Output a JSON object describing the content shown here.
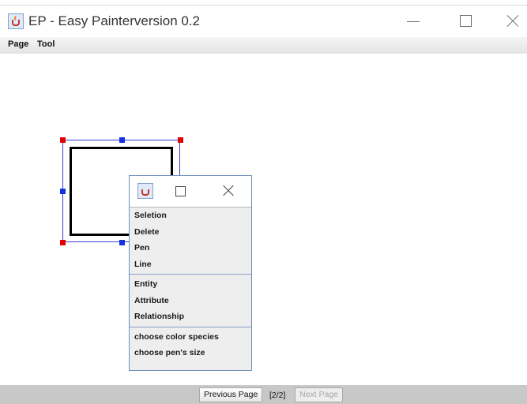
{
  "window": {
    "title": "EP - Easy Painterversion 0.2",
    "icon": "java-coffee-icon"
  },
  "menubar": {
    "items": [
      "Page",
      "Tool"
    ]
  },
  "popup": {
    "sections": [
      [
        "Seletion",
        "Delete",
        "Pen",
        "Line"
      ],
      [
        "Entity",
        "Attribute",
        "Relationship"
      ],
      [
        "choose color species",
        "choose pen's size"
      ]
    ]
  },
  "pager": {
    "prev_label": "Previous Page",
    "indicator": "[2/2]",
    "next_label": "Next Page"
  },
  "colors": {
    "handle_corner": "#e00000",
    "handle_edge": "#1530e0",
    "selection_border": "#3a3ad6",
    "shape_stroke": "#000000"
  }
}
